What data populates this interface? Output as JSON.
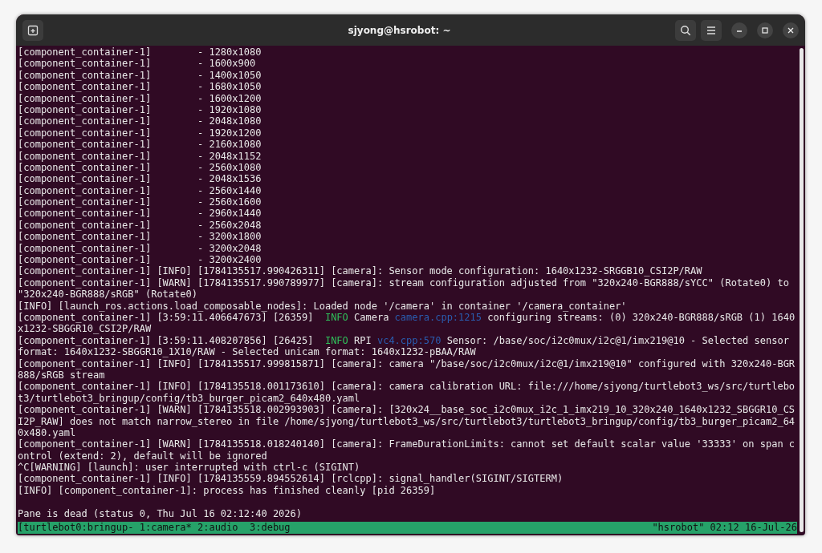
{
  "window": {
    "title": "sjyong@hsrobot: ~"
  },
  "terminal_lines": [
    [
      {
        "text": "[component_container-1]        - 1280x1080",
        "kind": "plain"
      }
    ],
    [
      {
        "text": "[component_container-1]        - 1600x900",
        "kind": "plain"
      }
    ],
    [
      {
        "text": "[component_container-1]        - 1400x1050",
        "kind": "plain"
      }
    ],
    [
      {
        "text": "[component_container-1]        - 1680x1050",
        "kind": "plain"
      }
    ],
    [
      {
        "text": "[component_container-1]        - 1600x1200",
        "kind": "plain"
      }
    ],
    [
      {
        "text": "[component_container-1]        - 1920x1080",
        "kind": "plain"
      }
    ],
    [
      {
        "text": "[component_container-1]        - 2048x1080",
        "kind": "plain"
      }
    ],
    [
      {
        "text": "[component_container-1]        - 1920x1200",
        "kind": "plain"
      }
    ],
    [
      {
        "text": "[component_container-1]        - 2160x1080",
        "kind": "plain"
      }
    ],
    [
      {
        "text": "[component_container-1]        - 2048x1152",
        "kind": "plain"
      }
    ],
    [
      {
        "text": "[component_container-1]        - 2560x1080",
        "kind": "plain"
      }
    ],
    [
      {
        "text": "[component_container-1]        - 2048x1536",
        "kind": "plain"
      }
    ],
    [
      {
        "text": "[component_container-1]        - 2560x1440",
        "kind": "plain"
      }
    ],
    [
      {
        "text": "[component_container-1]        - 2560x1600",
        "kind": "plain"
      }
    ],
    [
      {
        "text": "[component_container-1]        - 2960x1440",
        "kind": "plain"
      }
    ],
    [
      {
        "text": "[component_container-1]        - 2560x2048",
        "kind": "plain"
      }
    ],
    [
      {
        "text": "[component_container-1]        - 3200x1800",
        "kind": "plain"
      }
    ],
    [
      {
        "text": "[component_container-1]        - 3200x2048",
        "kind": "plain"
      }
    ],
    [
      {
        "text": "[component_container-1]        - 3200x2400",
        "kind": "plain"
      }
    ],
    [
      {
        "text": "[component_container-1] [INFO] [1784135517.990426311] [camera]: Sensor mode configuration: 1640x1232-SRGGB10_CSI2P/RAW",
        "kind": "plain"
      }
    ],
    [
      {
        "text": "[component_container-1] [WARN] [1784135517.990789977] [camera]: stream configuration adjusted from \"320x240-BGR888/sYCC\" (Rotate0) to",
        "kind": "plain"
      }
    ],
    [
      {
        "text": "\"320x240-BGR888/sRGB\" (Rotate0)",
        "kind": "plain"
      }
    ],
    [
      {
        "text": "[INFO] [launch_ros.actions.load_composable_nodes]: Loaded node '/camera' in container '/camera_container'",
        "kind": "plain"
      }
    ],
    [
      {
        "text": "[component_container-1] [3:59:11.406647673] [26359]  ",
        "kind": "plain"
      },
      {
        "text": "INFO",
        "kind": "level"
      },
      {
        "text": " Camera ",
        "kind": "plain"
      },
      {
        "text": "camera.cpp:1215",
        "kind": "source"
      },
      {
        "text": " configuring streams: (0) 320x240-BGR888/sRGB (1) 1640",
        "kind": "plain"
      }
    ],
    [
      {
        "text": "x1232-SBGGR10_CSI2P/RAW",
        "kind": "plain"
      }
    ],
    [
      {
        "text": "[component_container-1] [3:59:11.408207856] [26425]  ",
        "kind": "plain"
      },
      {
        "text": "INFO",
        "kind": "level"
      },
      {
        "text": " RPI ",
        "kind": "plain"
      },
      {
        "text": "vc4.cpp:570",
        "kind": "source"
      },
      {
        "text": " Sensor: /base/soc/i2c0mux/i2c@1/imx219@10 - Selected sensor",
        "kind": "plain"
      }
    ],
    [
      {
        "text": "format: 1640x1232-SBGGR10_1X10/RAW - Selected unicam format: 1640x1232-pBAA/RAW",
        "kind": "plain"
      }
    ],
    [
      {
        "text": "[component_container-1] [INFO] [1784135517.999815871] [camera]: camera \"/base/soc/i2c0mux/i2c@1/imx219@10\" configured with 320x240-BGR",
        "kind": "plain"
      }
    ],
    [
      {
        "text": "888/sRGB stream",
        "kind": "plain"
      }
    ],
    [
      {
        "text": "[component_container-1] [INFO] [1784135518.001173610] [camera]: camera calibration URL: file:///home/sjyong/turtlebot3_ws/src/turtlebo",
        "kind": "plain"
      }
    ],
    [
      {
        "text": "t3/turtlebot3_bringup/config/tb3_burger_picam2_640x480.yaml",
        "kind": "plain"
      }
    ],
    [
      {
        "text": "[component_container-1] [WARN] [1784135518.002993903] [camera]: [320x24__base_soc_i2c0mux_i2c_1_imx219_10_320x240_1640x1232_SBGGR10_CS",
        "kind": "plain"
      }
    ],
    [
      {
        "text": "I2P_RAW] does not match narrow_stereo in file /home/sjyong/turtlebot3_ws/src/turtlebot3/turtlebot3_bringup/config/tb3_burger_picam2_64",
        "kind": "plain"
      }
    ],
    [
      {
        "text": "0x480.yaml",
        "kind": "plain"
      }
    ],
    [
      {
        "text": "[component_container-1] [WARN] [1784135518.018240140] [camera]: FrameDurationLimits: cannot set default scalar value '33333' on span c",
        "kind": "plain"
      }
    ],
    [
      {
        "text": "ontrol (extend: 2), default will be ignored",
        "kind": "plain"
      }
    ],
    [
      {
        "text": "^C[WARNING] [launch]: user interrupted with ctrl-c (SIGINT)",
        "kind": "plain"
      }
    ],
    [
      {
        "text": "[component_container-1] [INFO] [1784135559.894552614] [rclcpp]: signal_handler(SIGINT/SIGTERM)",
        "kind": "plain"
      }
    ],
    [
      {
        "text": "[INFO] [component_container-1]: process has finished cleanly [pid 26359]",
        "kind": "plain"
      }
    ]
  ],
  "pane_message": "Pane is dead (status 0, Thu Jul 16 02:12:40 2026)",
  "status_bar": {
    "left": "[turtlebot0:bringup- 1:camera* 2:audio  3:debug",
    "right": "\"hsrobot\" 02:12 16-Jul-26"
  }
}
